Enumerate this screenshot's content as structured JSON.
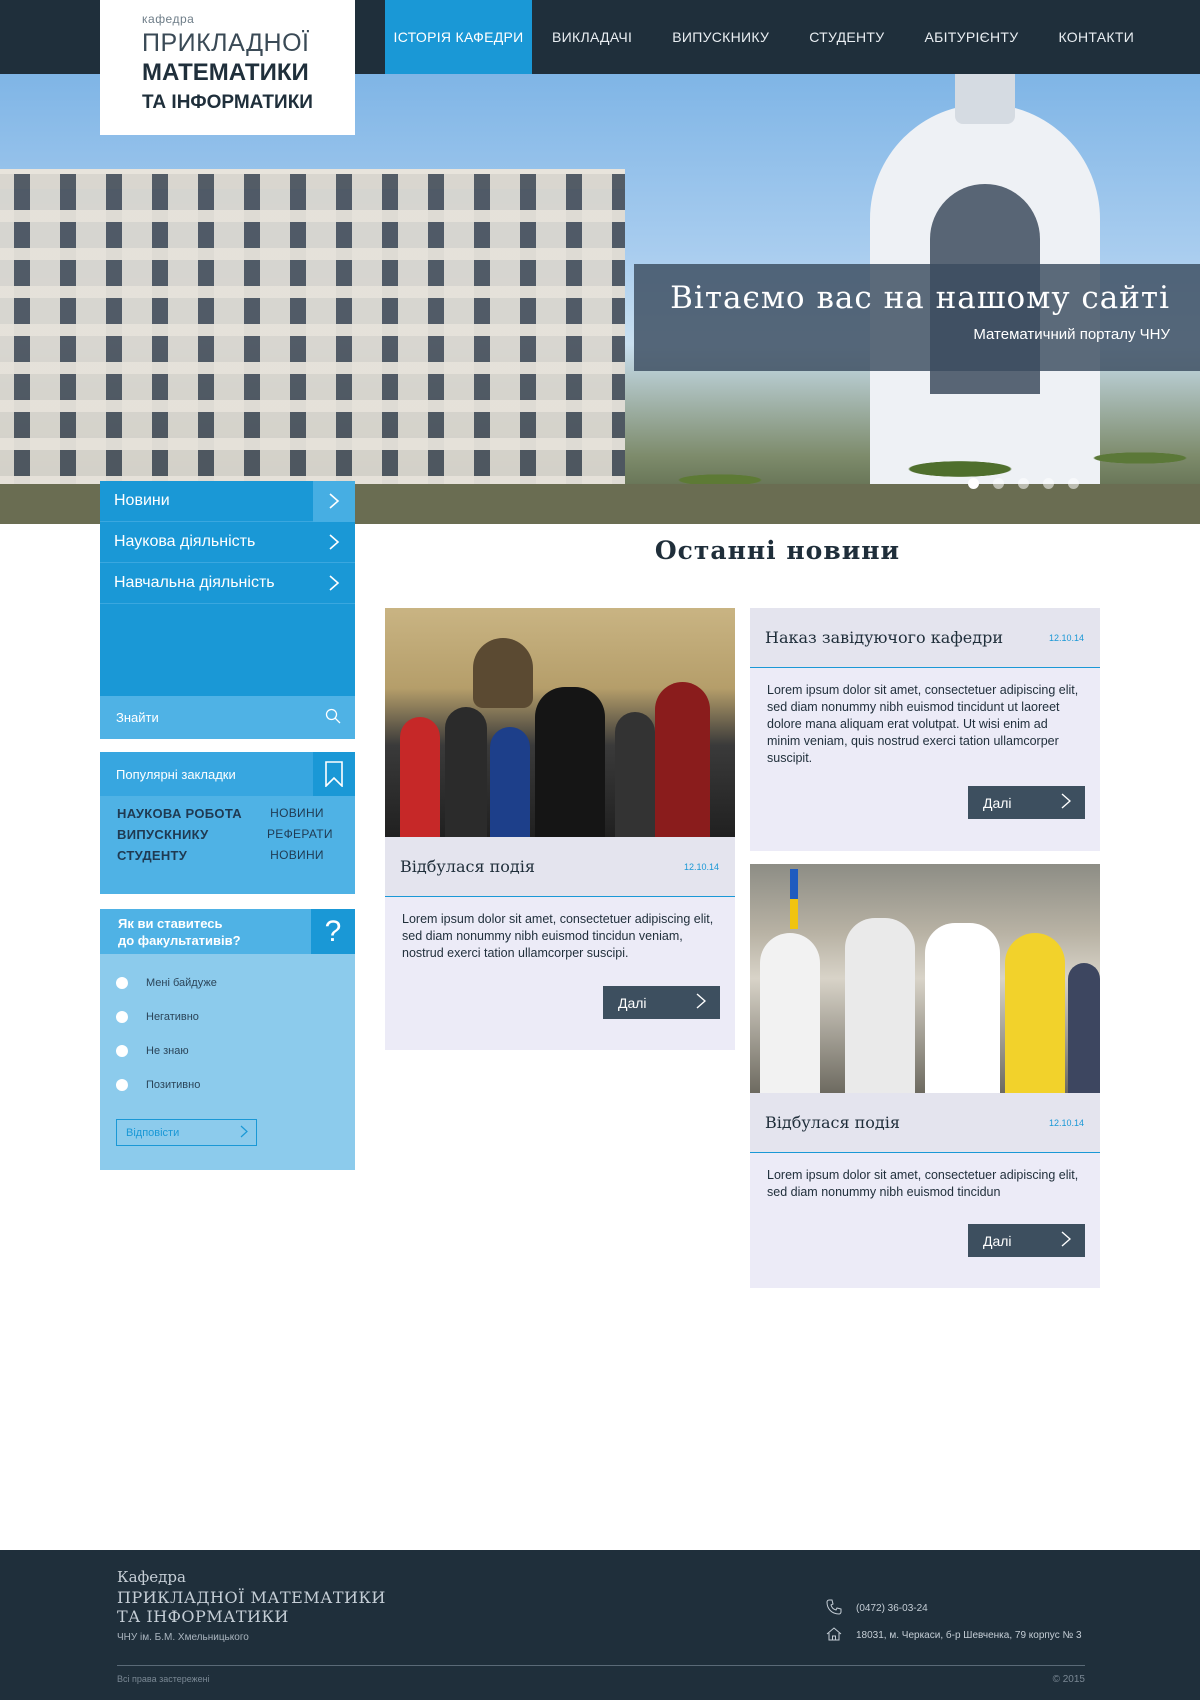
{
  "header": {
    "logo": {
      "small": "кафедра",
      "line1": "ПРИКЛАДНОЇ",
      "line2": "МАТЕМАТИКИ",
      "line3": "ТА ІНФОРМАТИКИ"
    },
    "nav": [
      {
        "label": "ІСТОРІЯ КАФЕДРИ",
        "active": true
      },
      {
        "label": "ВИКЛАДАЧІ",
        "active": false
      },
      {
        "label": "ВИПУСКНИКУ",
        "active": false
      },
      {
        "label": "СТУДЕНТУ",
        "active": false
      },
      {
        "label": "АБІТУРІЄНТУ",
        "active": false
      },
      {
        "label": "КОНТАКТИ",
        "active": false
      }
    ]
  },
  "hero": {
    "title": "Вітаємо вас на нашому сайті",
    "subtitle": "Математичний порталу ЧНУ",
    "slide_count": 5,
    "active_slide": 1
  },
  "sidebar": {
    "menu": [
      {
        "label": "Новини"
      },
      {
        "label": "Наукова діяльність"
      },
      {
        "label": "Навчальна діяльність"
      }
    ],
    "search_placeholder": "Знайти",
    "bookmarks": {
      "title": "Популярні закладки",
      "rows": [
        {
          "left": "НАУКОВА РОБОТА",
          "right": "НОВИНИ"
        },
        {
          "left": "ВИПУСКНИКУ",
          "right": "РЕФЕРАТИ"
        },
        {
          "left": "СТУДЕНТУ",
          "right": "НОВИНИ"
        }
      ]
    },
    "poll": {
      "question_line1": "Як ви ставитесь",
      "question_line2": "до факультативів?",
      "options": [
        "Мені байдуже",
        "Негативно",
        "Не знаю",
        "Позитивно"
      ],
      "submit": "Відповісти"
    }
  },
  "news": {
    "title": "Останні новини",
    "more_label": "Далі",
    "cards": [
      {
        "title": "Наказ завідуючого кафедри",
        "date": "12.10.14",
        "text": "Lorem ipsum dolor sit amet, consectetuer adipiscing elit, sed diam nonummy nibh euismod tincidunt ut laoreet dolore mana aliquam erat volutpat. Ut wisi enim ad minim veniam, quis nostrud exerci tation ullamcorper suscipit."
      },
      {
        "title": "Відбулася подія",
        "date": "12.10.14",
        "text": "Lorem ipsum dolor sit amet, consectetuer adipiscing elit, sed diam nonummy nibh euismod tincidun veniam, nostrud exerci tation ullamcorper suscipi."
      },
      {
        "title": "Відбулася подія",
        "date": "12.10.14",
        "text": "Lorem ipsum dolor sit amet, consectetuer adipiscing elit, sed diam nonummy nibh euismod tincidun"
      }
    ]
  },
  "footer": {
    "brand_line1": "Кафедра",
    "brand_line2": "ПРИКЛАДНОЇ МАТЕМАТИКИ",
    "brand_line3": "ТА ІНФОРМАТИКИ",
    "brand_line4": "ЧНУ ім. Б.М. Хмельницького",
    "phone": "(0472) 36-03-24",
    "address": "18031, м. Черкаси, б-р Шевченка, 79 корпус № 3",
    "rights": "Всі права застережені",
    "copyright": "© 2015"
  },
  "colors": {
    "dark": "#1f2f3b",
    "accent": "#1a98d6",
    "light_blue": "#8ccbec",
    "card_bg": "#ecebf7"
  }
}
